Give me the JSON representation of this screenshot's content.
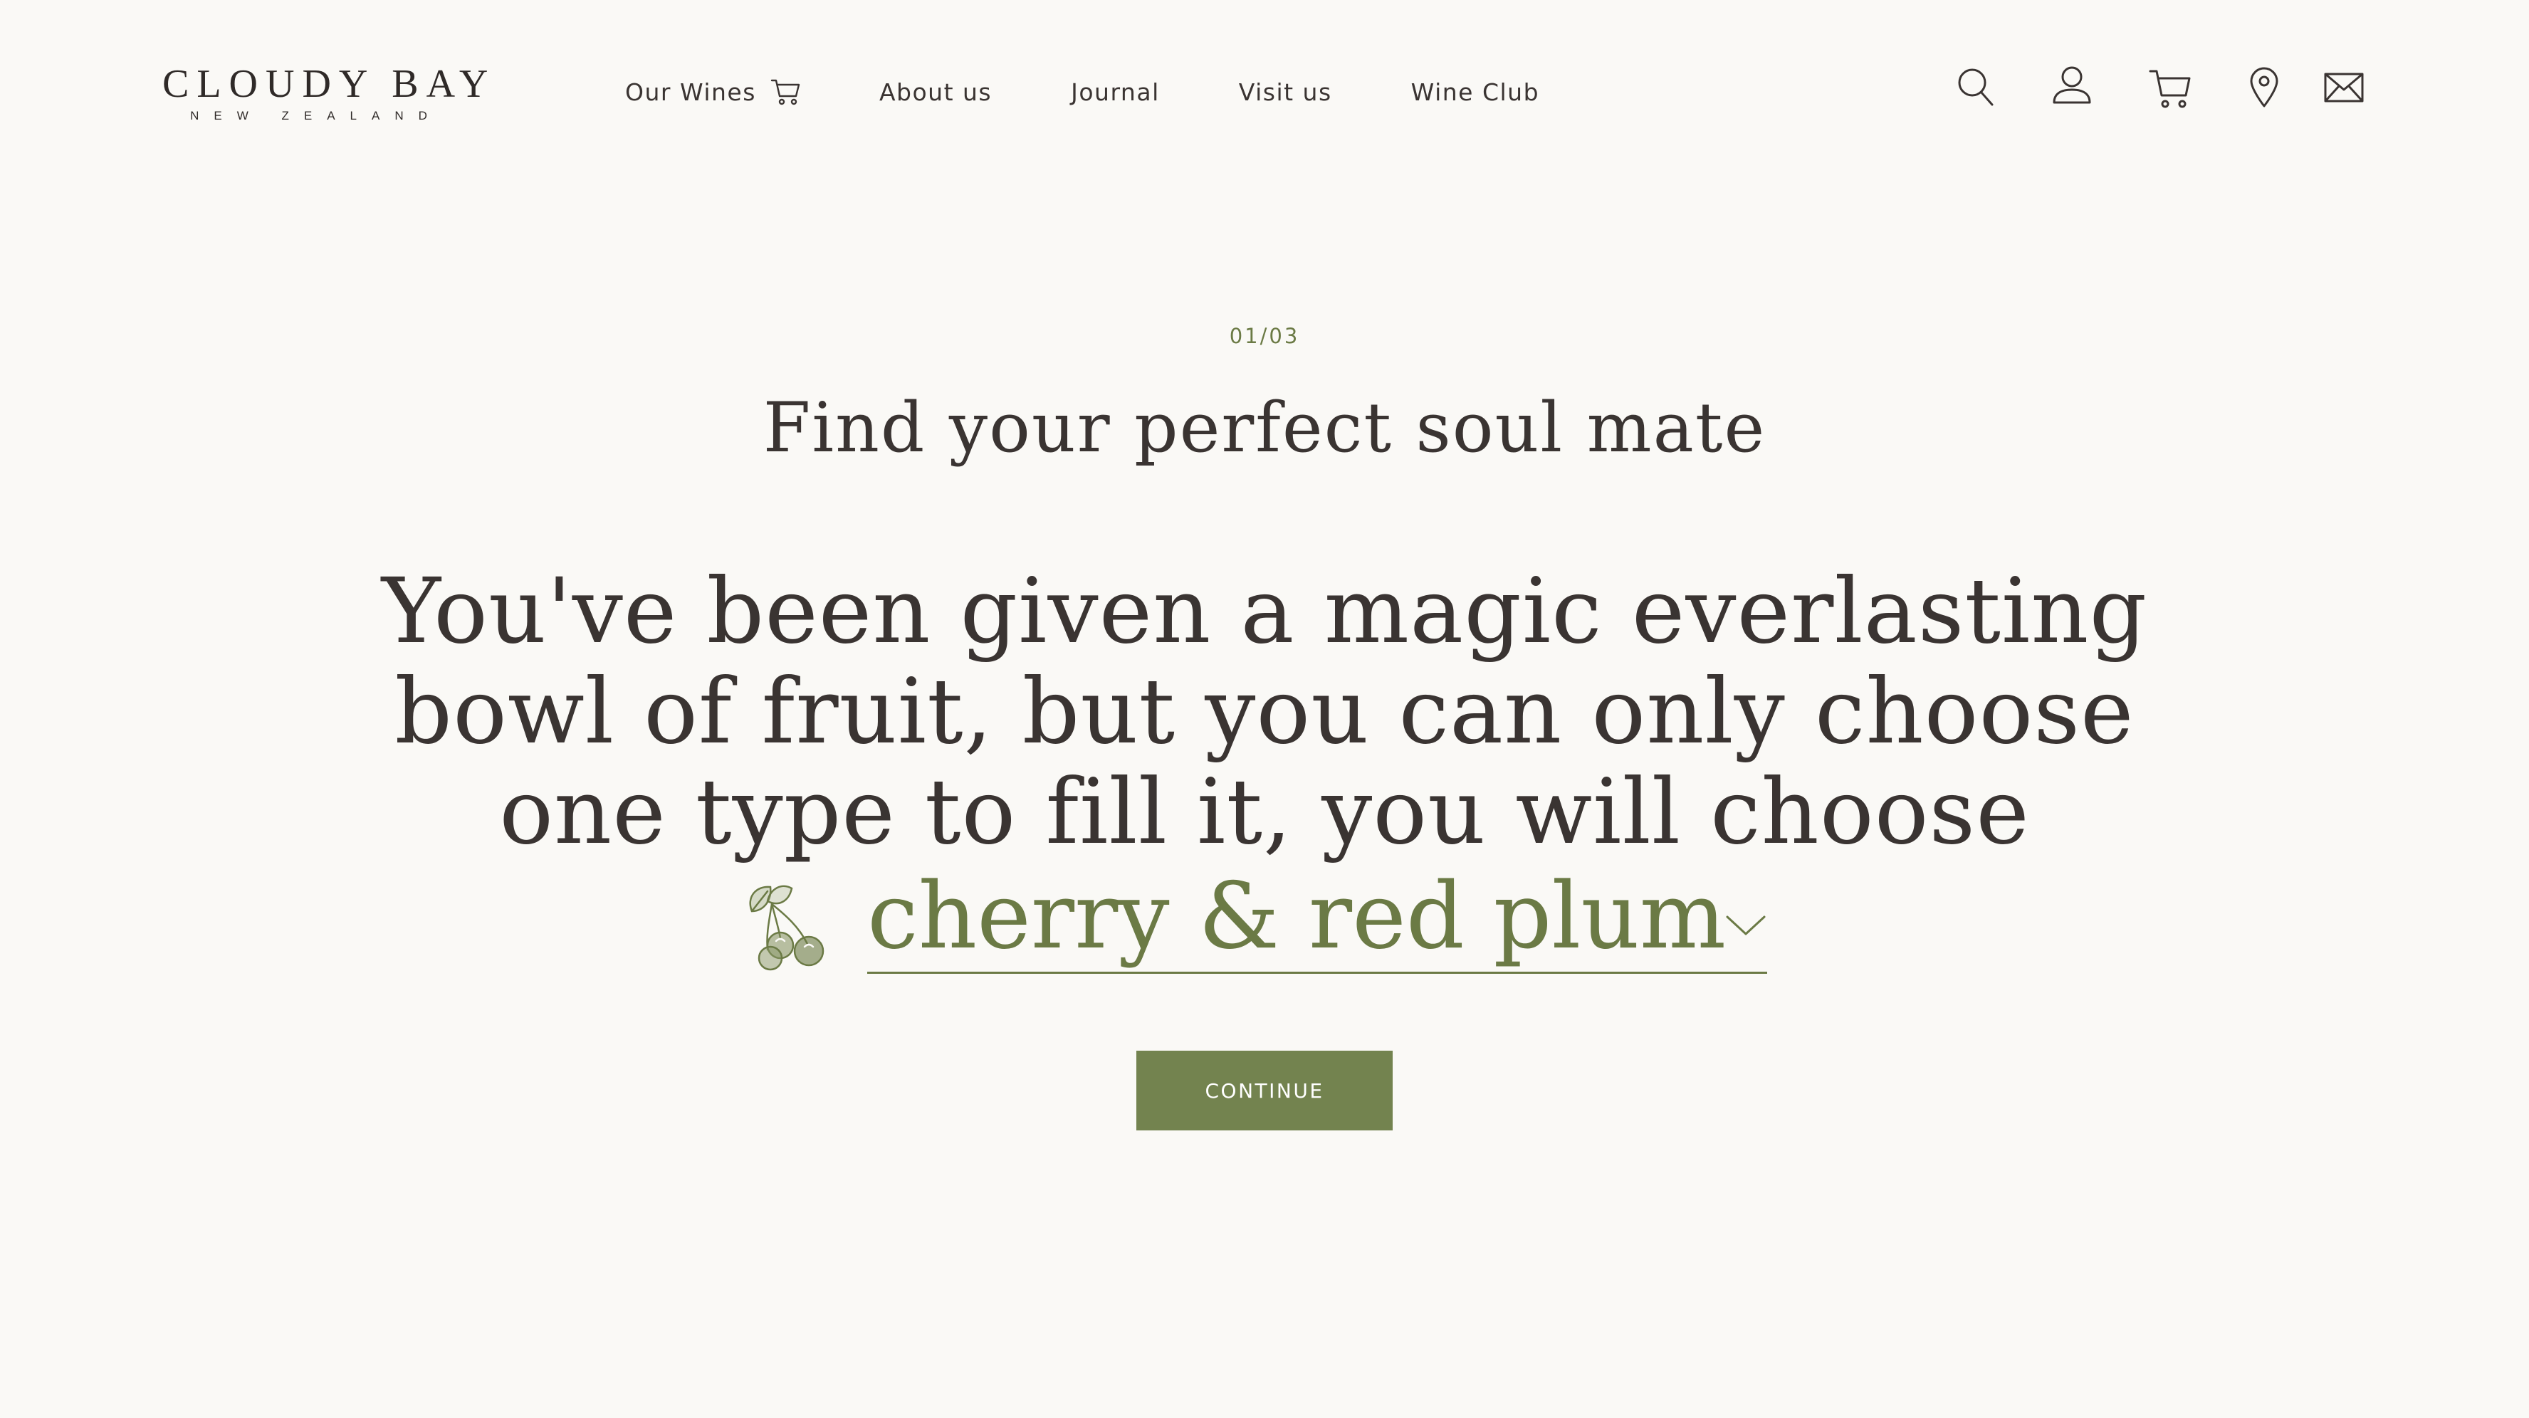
{
  "brand": {
    "name": "CLOUDY BAY",
    "tagline": "NEW ZEALAND"
  },
  "nav": {
    "items": [
      {
        "label": "Our Wines",
        "icon": "cart-icon"
      },
      {
        "label": "About us"
      },
      {
        "label": "Journal"
      },
      {
        "label": "Visit us"
      },
      {
        "label": "Wine Club"
      }
    ]
  },
  "utility_icons": [
    "search-icon",
    "account-icon",
    "cart-icon",
    "location-pin-icon",
    "mail-icon"
  ],
  "quiz": {
    "step": "01/03",
    "title": "Find your perfect soul mate",
    "question": "You've been given a magic everlasting bowl of fruit, but you can only choose one type to fill it, you will choose",
    "selected_answer": "cherry & red plum",
    "answer_icon": "cherry-icon",
    "continue_label": "CONTINUE"
  },
  "colors": {
    "background": "#faf9f6",
    "text": "#3a3432",
    "accent": "#6b7a45",
    "button": "#73834f"
  }
}
